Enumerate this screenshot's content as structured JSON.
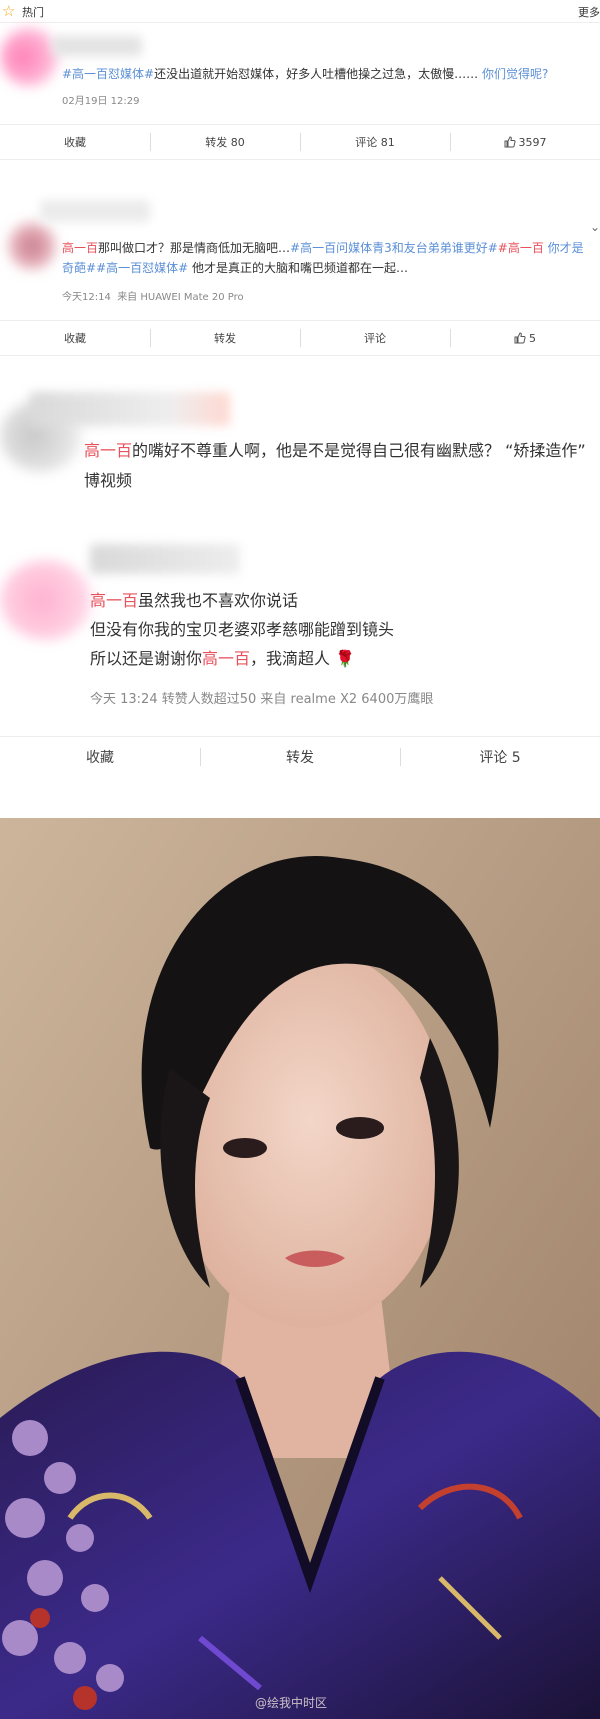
{
  "header": {
    "title": "热门",
    "more": "更多"
  },
  "post1": {
    "tag": "#高一百怼媒体#",
    "text": "还没出道就开始怼媒体，好多人吐槽他操之过急，太傲慢……",
    "question": "你们觉得呢?",
    "time": "02月19日 12:29",
    "actions": {
      "collect": "收藏",
      "repost": "转发 80",
      "comment": "评论 81",
      "like": "3597"
    }
  },
  "post2": {
    "name": "高一百",
    "text1": "那叫做口才？那是情商低加无脑吧…",
    "tag1": "#高一百问媒体青3和友台弟弟谁更好#",
    "tag2a": "#高一百",
    "tag2b": "你才是奇葩#",
    "tag3": "#高一百怼媒体#",
    "text2": " 他才是真正的大脑和嘴巴频道都在一起…",
    "time": "今天12:14",
    "source": "来自 HUAWEI Mate 20 Pro",
    "actions": {
      "collect": "收藏",
      "repost": "转发",
      "comment": "评论",
      "like": "5"
    }
  },
  "post3": {
    "name": "高一百",
    "text": "的嘴好不尊重人啊，他是不是觉得自己很有幽默感？ “矫揉造作”",
    "extra": "博视频"
  },
  "post4": {
    "name1": "高一百",
    "line1": "虽然我也不喜欢你说话",
    "line2": "但没有你我的宝贝老婆邓孝慈哪能蹭到镜头",
    "line3a": "所以还是谢谢你",
    "name2": "高一百",
    "line3b": "，我滴超人",
    "emoji": "🌹",
    "meta": "今天 13:24 转赞人数超过50   来自 realme X2 6400万鹰眼",
    "actions": {
      "collect": "收藏",
      "repost": "转发",
      "comment": "评论 5"
    }
  },
  "photo": {
    "watermark": "@绘我中时区"
  },
  "colors": {
    "accent_red": "#e8505b",
    "link_blue": "#5b8fd6"
  }
}
